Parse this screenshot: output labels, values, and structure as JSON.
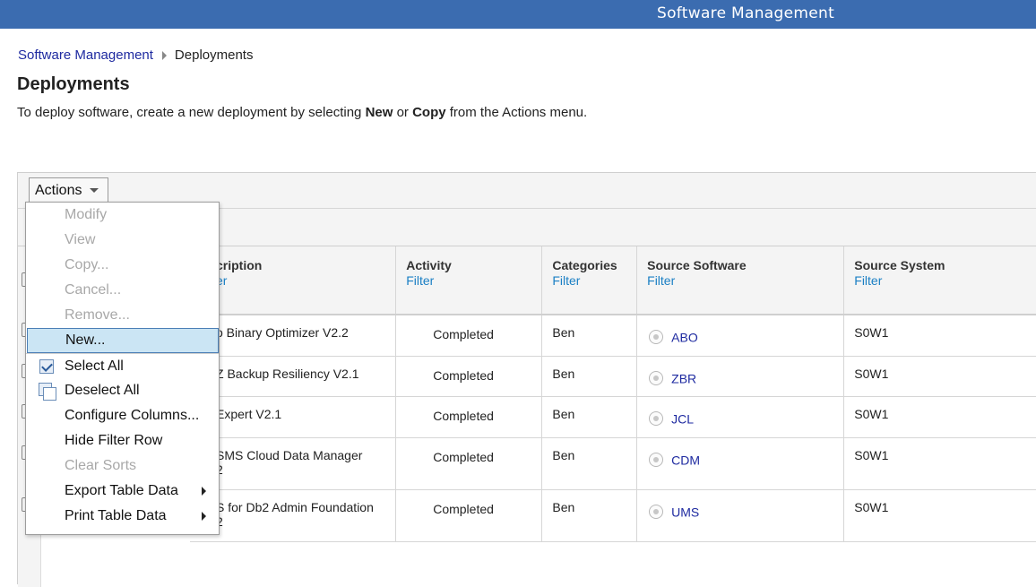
{
  "app": {
    "title": "Software Management"
  },
  "breadcrumb": {
    "parent": "Software Management",
    "current": "Deployments"
  },
  "page": {
    "title": "Deployments",
    "intro_prefix": "To deploy software, create a new deployment by selecting ",
    "intro_new": "New",
    "intro_or": " or ",
    "intro_copy": "Copy",
    "intro_suffix": " from the Actions menu."
  },
  "toolbar": {
    "actions_label": "Actions"
  },
  "table": {
    "columns": [
      {
        "label": "Description",
        "visible_label": "cription",
        "filter": "Filter",
        "visible_filter": "er"
      },
      {
        "label": "Activity",
        "filter": "Filter"
      },
      {
        "label": "Categories",
        "filter": "Filter"
      },
      {
        "label": "Source Software",
        "filter": "Filter"
      },
      {
        "label": "Source System",
        "filter": "Filter"
      }
    ],
    "rows": [
      {
        "desc_line1": "o Binary Optimizer V2.2",
        "desc_line2": "",
        "activity": "Completed",
        "category": "Ben",
        "source_software": "ABO",
        "source_system": "S0W1"
      },
      {
        "desc_line1": "Z Backup Resiliency V2.1",
        "desc_line2": "",
        "activity": "Completed",
        "category": "Ben",
        "source_software": "ZBR",
        "source_system": "S0W1"
      },
      {
        "desc_line1": "Expert V2.1",
        "desc_line2": "",
        "activity": "Completed",
        "category": "Ben",
        "source_software": "JCL",
        "source_system": "S0W1"
      },
      {
        "desc_line1": "SMS Cloud Data Manager",
        "desc_line2": "2",
        "activity": "Completed",
        "category": "Ben",
        "source_software": "CDM",
        "source_system": "S0W1"
      },
      {
        "desc_line1": "S for Db2 Admin Foundation",
        "desc_line2": "2",
        "activity": "Completed",
        "category": "Ben",
        "source_software": "UMS",
        "source_system": "S0W1"
      }
    ]
  },
  "actions_menu": {
    "items": [
      {
        "label": "Modify",
        "state": "disabled"
      },
      {
        "label": "View",
        "state": "disabled"
      },
      {
        "label": "Copy...",
        "state": "disabled"
      },
      {
        "label": "Cancel...",
        "state": "disabled"
      },
      {
        "label": "Remove...",
        "state": "disabled"
      },
      {
        "label": "New...",
        "state": "highlighted"
      },
      {
        "label": "Select All",
        "state": "enabled",
        "icon": "select-all-icon"
      },
      {
        "label": "Deselect All",
        "state": "enabled",
        "icon": "deselect-all-icon"
      },
      {
        "label": "Configure Columns...",
        "state": "enabled"
      },
      {
        "label": "Hide Filter Row",
        "state": "enabled"
      },
      {
        "label": "Clear Sorts",
        "state": "disabled"
      },
      {
        "label": "Export Table Data",
        "state": "enabled",
        "submenu": true
      },
      {
        "label": "Print Table Data",
        "state": "enabled",
        "submenu": true
      }
    ]
  },
  "colors": {
    "topbar": "#3b6cb0",
    "link": "#1e2aa0",
    "filter_link": "#1a7fc4",
    "menu_highlight": "#cbe5f4"
  }
}
